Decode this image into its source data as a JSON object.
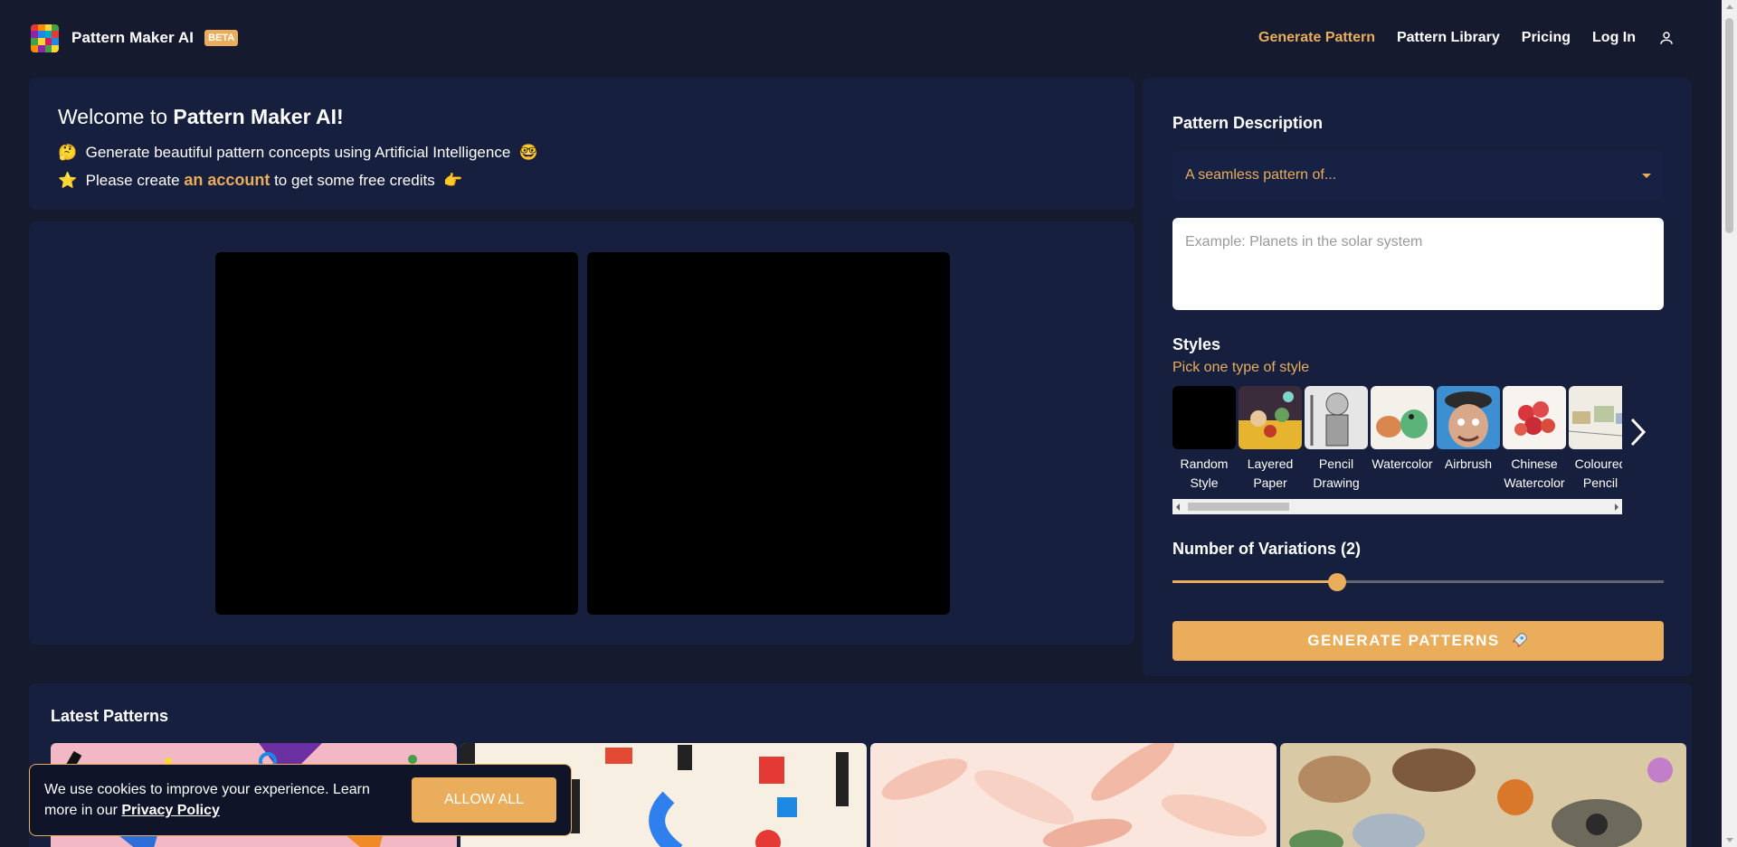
{
  "brand": {
    "name": "Pattern Maker AI",
    "badge": "BETA"
  },
  "nav": {
    "items": [
      {
        "label": "Generate Pattern",
        "active": true
      },
      {
        "label": "Pattern Library",
        "active": false
      },
      {
        "label": "Pricing",
        "active": false
      },
      {
        "label": "Log In",
        "active": false
      }
    ],
    "user_icon": "user-icon"
  },
  "welcome": {
    "title_prefix": "Welcome to ",
    "title_brand": "Pattern Maker AI!",
    "line1_emoji": "🤔",
    "line1_text": "Generate beautiful pattern concepts using Artificial Intelligence",
    "line1_emoji_end": "🤓",
    "line2_emoji": "⭐",
    "line2_before": "Please create ",
    "line2_link": "an account",
    "line2_after": " to get some free credits",
    "line2_emoji_end": "👉"
  },
  "form": {
    "description_label": "Pattern Description",
    "select_value": "A seamless pattern of...",
    "textarea_placeholder": "Example: Planets in the solar system",
    "styles_label": "Styles",
    "styles_sub": "Pick one type of style",
    "styles": [
      {
        "label": "Random Style"
      },
      {
        "label": "Layered Paper"
      },
      {
        "label": "Pencil Drawing"
      },
      {
        "label": "Watercolor"
      },
      {
        "label": "Airbrush"
      },
      {
        "label": "Chinese Watercolor"
      },
      {
        "label": "Coloured Pencil"
      }
    ],
    "variations_label": "Number of Variations (2)",
    "variations_fraction": 0.335,
    "generate_label": "GENERATE PATTERNS",
    "generate_icon": "rocket-icon"
  },
  "latest": {
    "title": "Latest Patterns"
  },
  "cookie": {
    "text": "We use cookies to improve your experience. Learn more in our ",
    "link": "Privacy Policy",
    "button": "ALLOW ALL"
  },
  "colors": {
    "accent": "#e9ad5c",
    "background": "#161a2e",
    "panel": "#16203e"
  }
}
